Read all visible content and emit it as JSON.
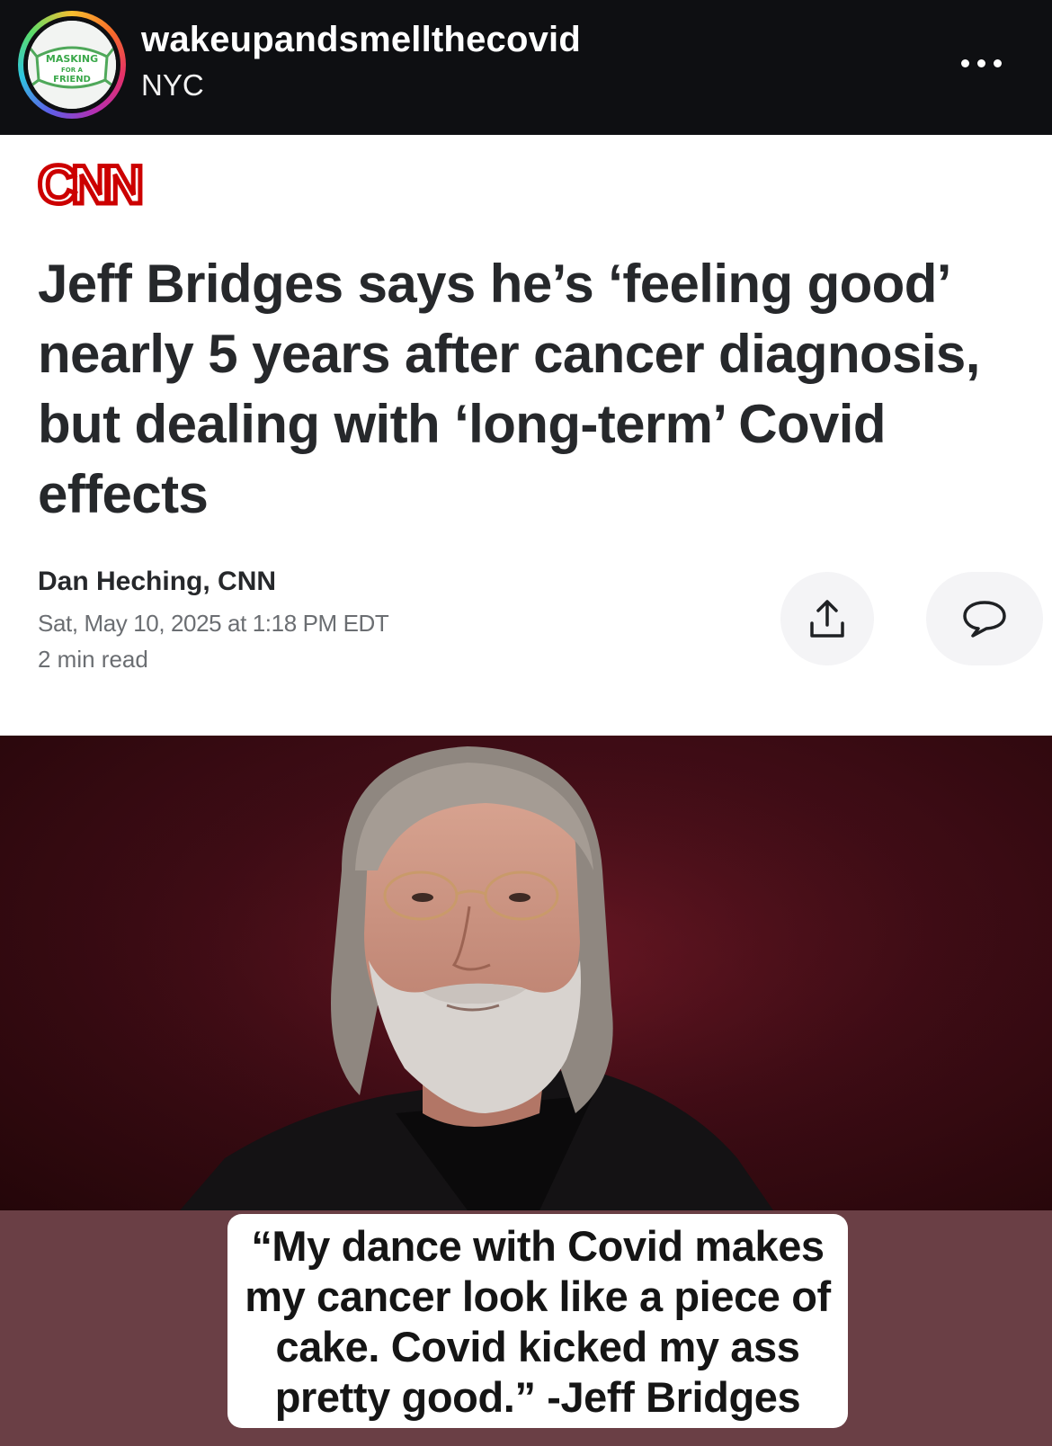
{
  "post_header": {
    "username": "wakeupandsmellthecovid",
    "location": "NYC",
    "avatar_logo_text": [
      "MASKING",
      "FOR A",
      "FRIEND"
    ],
    "more_icon": "more-horizontal-icon"
  },
  "article": {
    "source_logo": "CNN",
    "headline": "Jeff Bridges says he’s ‘feeling good’ nearly 5 years after cancer diagnosis, but dealing with ‘long-term’ Covid effects",
    "author": "Dan Heching, CNN",
    "date": "Sat, May 10, 2025 at 1:18 PM EDT",
    "read_time": "2 min read",
    "share_icon": "share-icon",
    "comment_icon": "comment-icon"
  },
  "caption": {
    "quote": "“My dance with Covid makes my cancer look like a piece of cake.  Covid kicked my ass pretty good.” -Jeff Bridges"
  },
  "colors": {
    "cnn_red": "#cc0000",
    "header_bg": "#0e0f12",
    "caption_band": "#6a3f45",
    "photo_bg": "#3e0c15"
  }
}
